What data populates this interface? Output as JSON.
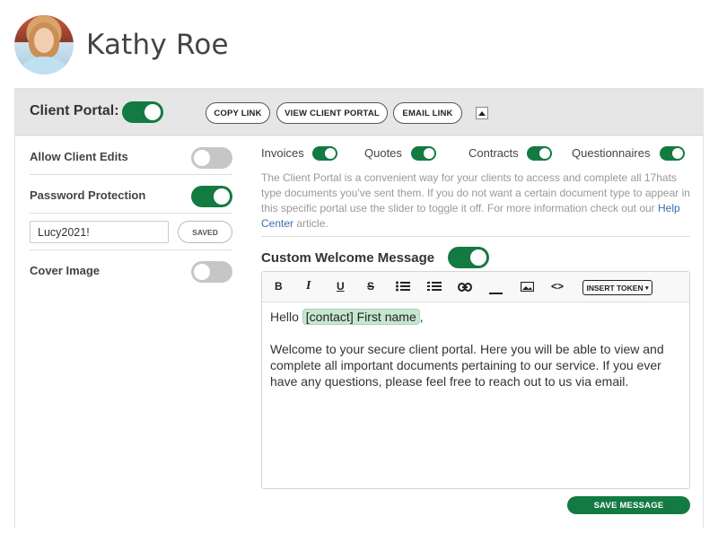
{
  "profile": {
    "name": "Kathy Roe"
  },
  "portal": {
    "label": "Client Portal:",
    "copy_link": "COPY LINK",
    "view_portal": "VIEW CLIENT PORTAL",
    "email_link": "EMAIL LINK"
  },
  "settings": {
    "allow_edits": "Allow Client Edits",
    "password_protection": "Password Protection",
    "password_value": "Lucy2021!",
    "saved": "SAVED",
    "cover_image": "Cover Image"
  },
  "doc_types": [
    {
      "label": "Invoices"
    },
    {
      "label": "Quotes"
    },
    {
      "label": "Contracts"
    },
    {
      "label": "Questionnaires"
    }
  ],
  "description": {
    "text": "The Client Portal is a convenient way for your clients to access and complete all 17hats type documents you've sent them. If you do not want a certain document type to appear in this specific portal use the slider to toggle it off. For more information check out our ",
    "link": "Help Center",
    "suffix": " article."
  },
  "welcome": {
    "label": "Custom Welcome Message",
    "insert_token": "INSERT TOKEN",
    "hello": "Hello",
    "token": "[contact] First name",
    "comma": ",",
    "message": "Welcome to your secure client portal. Here you will be able to view and complete all important documents pertaining to our service. If you ever have any questions, please feel free to reach out to us via email.",
    "save": "SAVE MESSAGE"
  },
  "toolbar_icons": [
    "bold-icon",
    "italic-icon",
    "underline-icon",
    "strikethrough-icon",
    "bullet-list-icon",
    "numbered-list-icon",
    "link-icon",
    "horizontal-rule-icon",
    "image-icon",
    "code-icon"
  ],
  "colors": {
    "accent": "#137a41",
    "toggle_off": "#c6c6c6",
    "token_bg": "#c7e6d0"
  }
}
